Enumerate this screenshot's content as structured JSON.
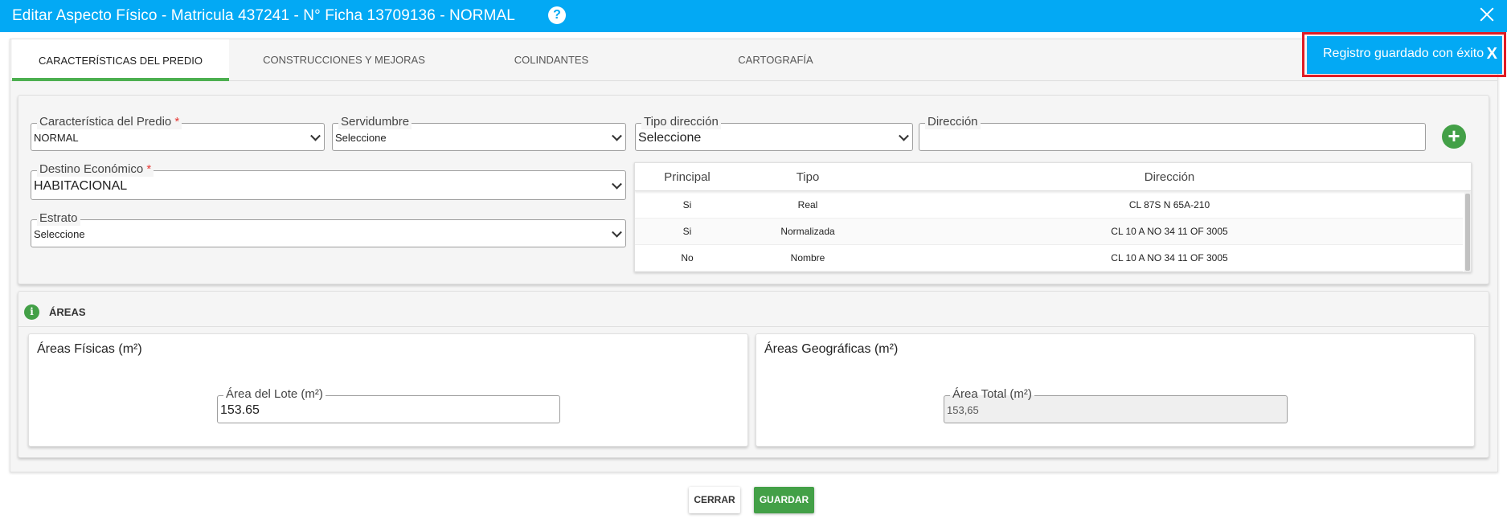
{
  "window": {
    "title": "Editar Aspecto Físico - Matricula 437241 - N° Ficha 13709136 - NORMAL",
    "help_glyph": "?",
    "accent_color": "#03a9f4"
  },
  "tabs": [
    {
      "label": "CARACTERÍSTICAS DEL PREDIO",
      "active": true
    },
    {
      "label": "CONSTRUCCIONES Y MEJORAS",
      "active": false
    },
    {
      "label": "COLINDANTES",
      "active": false
    },
    {
      "label": "CARTOGRAFÍA",
      "active": false
    }
  ],
  "toast": {
    "message": "Registro guardado con éxito",
    "close_glyph": "X"
  },
  "form": {
    "caracteristica": {
      "label": "Característica del Predio",
      "required_mark": "*",
      "value": "NORMAL"
    },
    "servidumbre": {
      "label": "Servidumbre",
      "value": "Seleccione"
    },
    "tipo_direccion": {
      "label": "Tipo dirección",
      "value": "Seleccione"
    },
    "direccion": {
      "label": "Dirección",
      "value": ""
    },
    "add_glyph": "+",
    "destino": {
      "label": "Destino Económico",
      "required_mark": "*",
      "value": "HABITACIONAL"
    },
    "estrato": {
      "label": "Estrato",
      "value": "Seleccione"
    }
  },
  "address_table": {
    "headers": [
      "Principal",
      "Tipo",
      "Dirección"
    ],
    "rows": [
      [
        "Si",
        "Real",
        "CL 87S N 65A-210"
      ],
      [
        "Si",
        "Normalizada",
        "CL 10 A NO 34 11 OF 3005"
      ],
      [
        "No",
        "Nombre",
        "CL 10 A NO 34 11 OF 3005"
      ]
    ]
  },
  "areas": {
    "section_title": "ÁREAS",
    "info_glyph": "i",
    "fisicas": {
      "title": "Áreas Físicas (m²)",
      "field_label": "Área del Lote (m²)",
      "value": "153.65"
    },
    "geograficas": {
      "title": "Áreas Geográficas (m²)",
      "field_label": "Área Total (m²)",
      "value": "153,65"
    }
  },
  "footer": {
    "close_label": "CERRAR",
    "save_label": "GUARDAR",
    "success_color": "#43a047"
  }
}
